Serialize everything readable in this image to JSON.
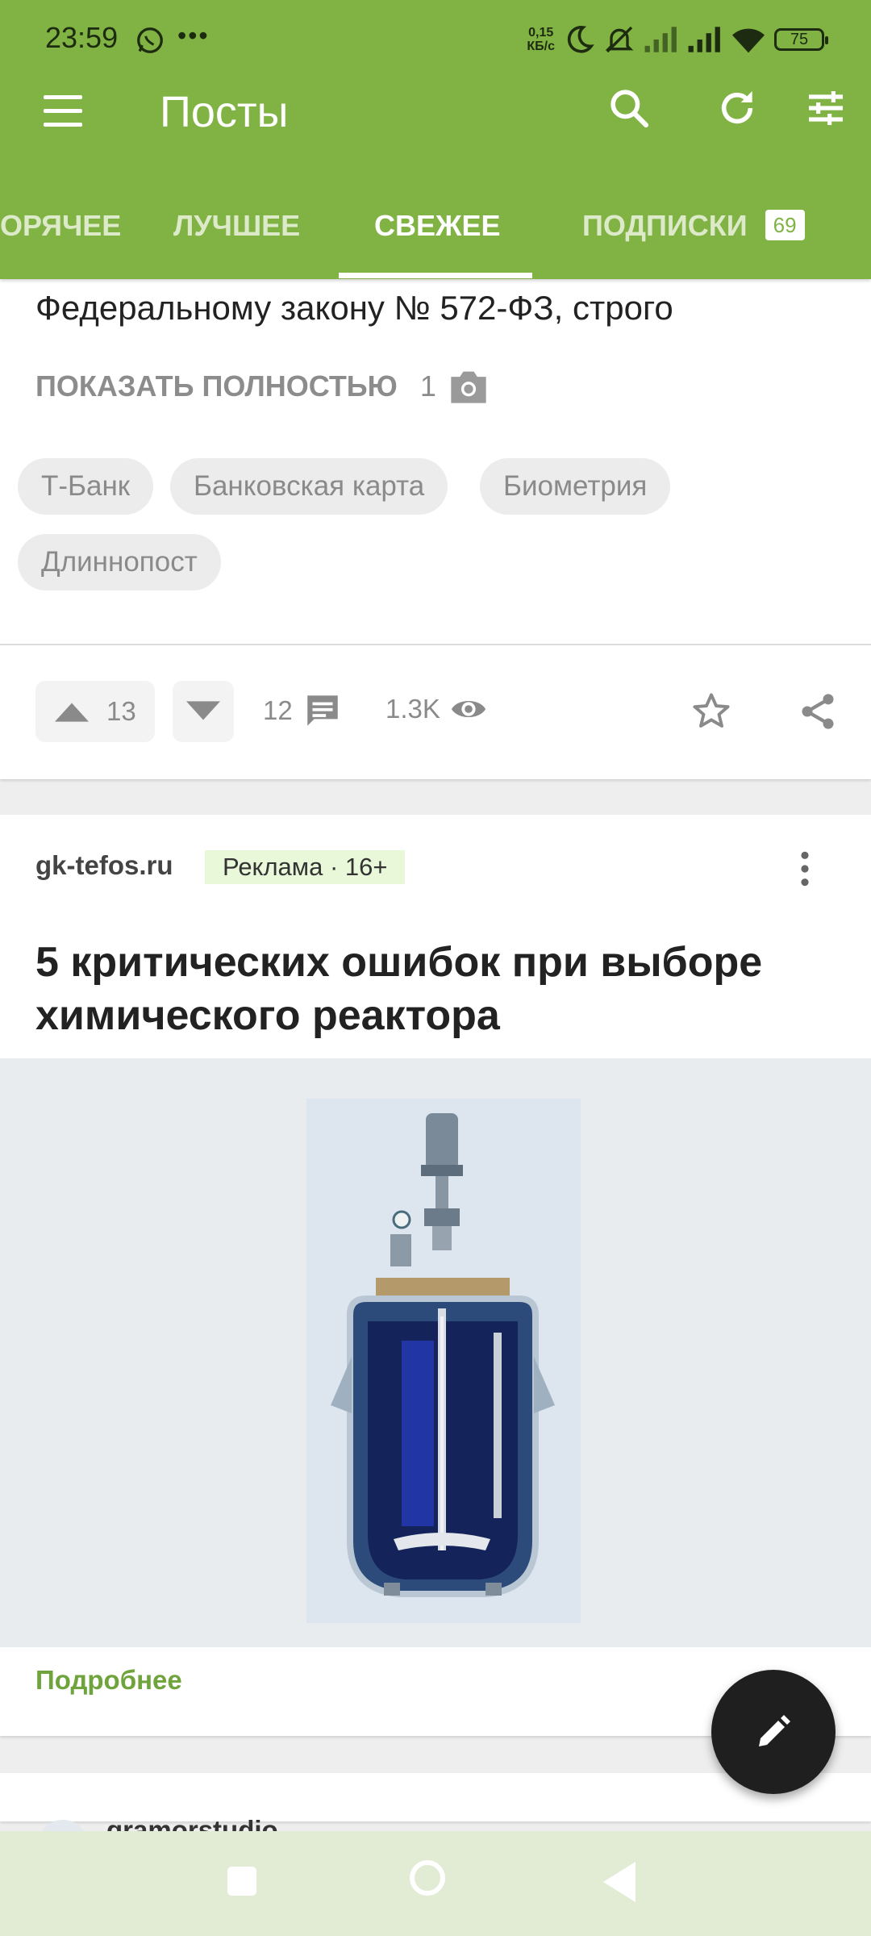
{
  "status_bar": {
    "time": "23:59",
    "net_speed_value": "0,15",
    "net_speed_unit": "КБ/с",
    "battery": "75"
  },
  "toolbar": {
    "title": "Посты"
  },
  "tabs": [
    {
      "label": "ГОРЯЧЕЕ",
      "visible_text": "ОРЯЧЕЕ"
    },
    {
      "label": "ЛУЧШЕЕ"
    },
    {
      "label": "СВЕЖЕЕ",
      "active": true
    },
    {
      "label": "ПОДПИСКИ",
      "badge": "69"
    }
  ],
  "post": {
    "text_line": "Федеральному закону № 572-ФЗ, строго",
    "show_full_label": "ПОКАЗАТЬ ПОЛНОСТЬЮ",
    "photo_count": "1",
    "tags": [
      "Т-Банк",
      "Банковская карта",
      "Биометрия",
      "Длиннопост"
    ],
    "rating_up": "13",
    "comments": "12",
    "views": "1.3K"
  },
  "ad": {
    "source": "gk-tefos.ru",
    "label": "Реклама · 16+",
    "title": "5 критических ошибок при выборе химического реактора",
    "more_label": "Подробнее"
  },
  "next_post": {
    "author": "gramorstudio"
  },
  "colors": {
    "header_green": "#80b343",
    "link_green": "#6fa43d",
    "ad_label_bg": "#e8f8d8",
    "fab": "#1f1f1f",
    "navbar": "#e2ecd5"
  },
  "icons": [
    "whatsapp-icon",
    "more-dots-icon",
    "moon-icon",
    "bell-off-icon",
    "signal-icon",
    "wifi-icon",
    "menu-icon",
    "search-icon",
    "refresh-icon",
    "filter-icon",
    "camera-icon",
    "arrow-up-icon",
    "arrow-down-icon",
    "comment-icon",
    "eye-icon",
    "star-icon",
    "share-icon",
    "kebab-menu-icon",
    "pencil-icon",
    "nav-square-icon",
    "nav-circle-icon",
    "nav-back-icon"
  ]
}
